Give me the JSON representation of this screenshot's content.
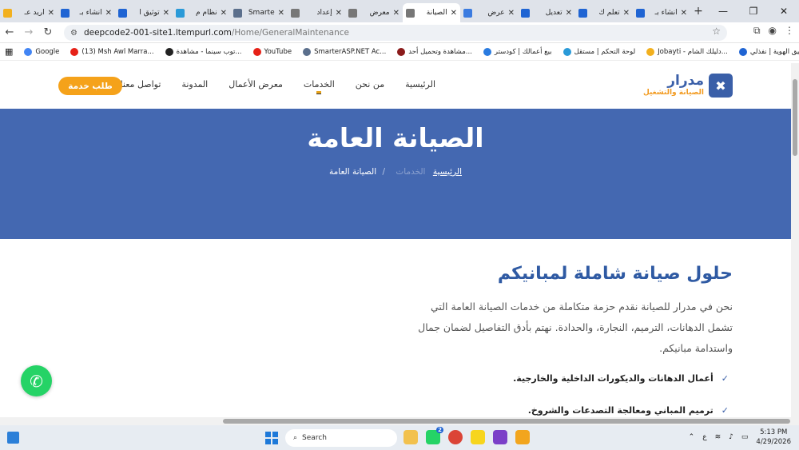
{
  "browser": {
    "tabs": [
      {
        "label": "اريد عـ",
        "color": "#f2b01e"
      },
      {
        "label": "انشاء بـ",
        "color": "#1f64d3"
      },
      {
        "label": "توثيق ا",
        "color": "#1f64d3"
      },
      {
        "label": "نظام م",
        "color": "#2a9ad8"
      },
      {
        "label": "Smarte",
        "color": "#5b6f8c"
      },
      {
        "label": "إعداد",
        "color": "#777777"
      },
      {
        "label": "معرض",
        "color": "#777777"
      },
      {
        "label": "الصيانة",
        "color": "#777777",
        "active": true
      },
      {
        "label": "عرض",
        "color": "#3a7be0"
      },
      {
        "label": "تعديل",
        "color": "#1f64d3"
      },
      {
        "label": "تعلم ك",
        "color": "#1f64d3"
      },
      {
        "label": "انشاء بـ",
        "color": "#1f64d3"
      }
    ],
    "new_tab": "+",
    "window_controls": {
      "minimize": "—",
      "restore": "❐",
      "close": "✕"
    },
    "address": {
      "host": "deepcode2-001-site1.ltempurl.com",
      "path": "/Home/GeneralMaintenance"
    },
    "bookmarks": [
      {
        "label": "Google",
        "color": "#4285f4"
      },
      {
        "label": "(13) Msh Awl Marra...",
        "color": "#e62117"
      },
      {
        "label": "توب سينما - مشاهدة...",
        "color": "#222222"
      },
      {
        "label": "YouTube",
        "color": "#e62117"
      },
      {
        "label": "SmarterASP.NET Ac...",
        "color": "#5b6f8c"
      },
      {
        "label": "مشاهدة وتحميل أحد...",
        "color": "#8b1b1b"
      },
      {
        "label": "بيع أعمالك | كودستر",
        "color": "#2a7be0"
      },
      {
        "label": "لوحة التحكم | مستقل",
        "color": "#2a9ad8"
      },
      {
        "label": "Jobayti - دليلك الشام...",
        "color": "#f2b01e"
      },
      {
        "label": "توثيق الهوية | نفذلي",
        "color": "#1f64d3"
      }
    ]
  },
  "site": {
    "logo": {
      "name": "مدرار",
      "tagline": "الصيانة والتشغيل",
      "icon": "wrench-screwdriver-icon",
      "color": "#3a5fa8",
      "accent": "#f29a1f"
    },
    "nav": [
      "الرئيسية",
      "من نحن",
      "الخدمات",
      "معرض الأعمال",
      "المدونة",
      "تواصل معنا"
    ],
    "cta": "طلب خدمة",
    "hero": {
      "title": "الصيانة العامة",
      "breadcrumb": {
        "home": "الرئيسية",
        "middle": "الخدمات",
        "current": "الصيانة العامة",
        "separator": "/"
      },
      "color": "#4468b1"
    },
    "section": {
      "title": "حلول صيانة شاملة لمبانيكم",
      "paragraph": "نحن في مدرار للصيانة نقدم حزمة متكاملة من خدمات الصيانة العامة التي تشمل الدهانات، الترميم، النجارة، والحدادة. نهتم بأدق التفاصيل لضمان جمال واستدامة مبانيكم.",
      "features": [
        "أعمال الدهانات والديكورات الداخلية والخارجية.",
        "ترميم المباني ومعالجة التصدعات والشروخ."
      ]
    },
    "whatsapp": {
      "icon": "whatsapp-icon",
      "color": "#25d366"
    }
  },
  "taskbar": {
    "search": "Search",
    "language": "ع",
    "time": "5:13 PM",
    "date": "4/29/2026",
    "badge": "2"
  }
}
